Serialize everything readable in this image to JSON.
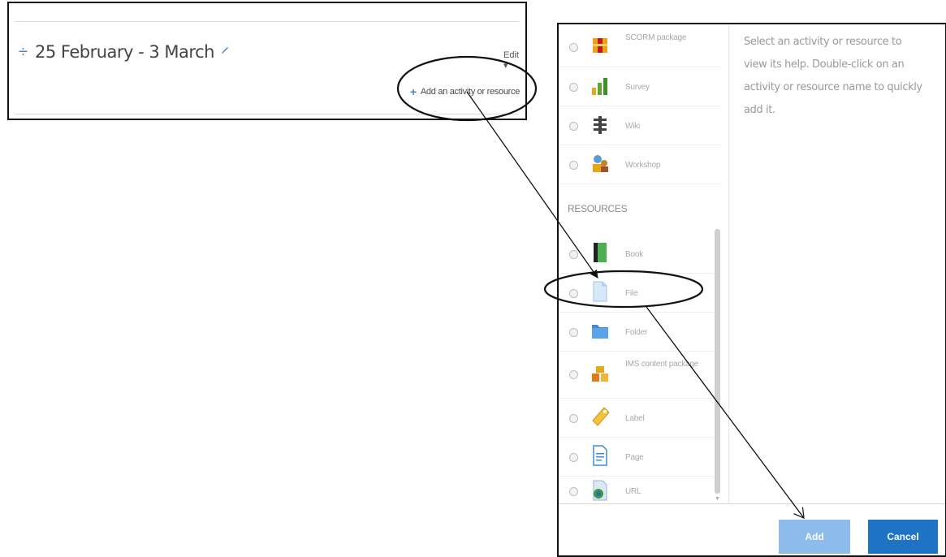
{
  "course": {
    "section_title": "25 February - 3 March",
    "edit_label": "Edit",
    "add_activity_label": "Add an activity or resource"
  },
  "chooser": {
    "help_text": "Select an activity or resource to view its help. Double-click on an activity or resource name to quickly add it.",
    "activities": [
      {
        "label": "SCORM package",
        "icon": "scorm-package-icon"
      },
      {
        "label": "Survey",
        "icon": "survey-icon"
      },
      {
        "label": "Wiki",
        "icon": "wiki-icon"
      },
      {
        "label": "Workshop",
        "icon": "workshop-icon"
      }
    ],
    "resources_heading": "RESOURCES",
    "resources": [
      {
        "label": "Book",
        "icon": "book-icon"
      },
      {
        "label": "File",
        "icon": "file-icon"
      },
      {
        "label": "Folder",
        "icon": "folder-icon"
      },
      {
        "label": "IMS content package",
        "icon": "ims-package-icon"
      },
      {
        "label": "Label",
        "icon": "label-icon"
      },
      {
        "label": "Page",
        "icon": "page-icon"
      },
      {
        "label": "URL",
        "icon": "url-icon"
      }
    ],
    "add_label": "Add",
    "cancel_label": "Cancel"
  },
  "colors": {
    "accent": "#1f73c4",
    "accent_light": "#8dbbeb",
    "link_blue": "#4a86c5"
  }
}
